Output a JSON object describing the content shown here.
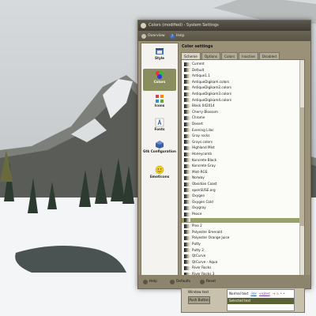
{
  "window": {
    "title": "Colors (modified) - System Settings"
  },
  "toolbar": {
    "overview_label": "Overview",
    "help_label": "Help",
    "help_icon_glyph": "?"
  },
  "sidebar": {
    "items": [
      {
        "label": "Style",
        "icon": "style-icon"
      },
      {
        "label": "Colors",
        "icon": "colors-icon"
      },
      {
        "label": "Icons",
        "icon": "icons-icon"
      },
      {
        "label": "Fonts",
        "icon": "fonts-icon"
      },
      {
        "label": "Gtk Configuration",
        "icon": "gtk-icon"
      },
      {
        "label": "Emoticons",
        "icon": "emoticons-icon"
      }
    ]
  },
  "content": {
    "heading": "Color settings",
    "tabs": [
      "Scheme",
      "Options",
      "Colors",
      "Inactive",
      "Disabled"
    ],
    "schemes": [
      "Current",
      "Default",
      "Antique1.1",
      "AntiqueDigikam.colors",
      "AntiqueDigikam2.colors",
      "AntiqueDigikam3.colors",
      "AntiqueDigikam4.colors",
      "Black 042014",
      "Cherry Blossom",
      "Chrome",
      "Desert",
      "Evening Lilac",
      "Gray rocks",
      "Grays.colors",
      "Highland Mist",
      "Honeycomb",
      "Koncrete Black",
      "Koncrete Gray",
      "Mint-RGS",
      "Norway",
      "Obsidian Coast",
      "openSUSE.org",
      "Oxygen",
      "Oxygen Cold",
      "Oxygray",
      "Peace",
      "",
      "Pine 2",
      "Polyester Emerald",
      "Polyester Orange Juice",
      "Putty",
      "Putty 2",
      "QtCurve",
      "QtCurve - Aqua",
      "River Rocks",
      "River Rocks 3"
    ],
    "selected_index": 26
  },
  "preview": {
    "section_label": "Preview",
    "window_text": "Window text",
    "push_button": "Push Button",
    "normal_text": "Normal text",
    "link": "link",
    "visited": "visited",
    "trailing": "→ ⚠ • •",
    "selected_text": "Selected text"
  },
  "bottom": {
    "help": "Help",
    "defaults": "Defaults",
    "reset": "Reset"
  },
  "colors": {
    "accent": "#9aa06a",
    "window_bg": "#9a9178"
  }
}
